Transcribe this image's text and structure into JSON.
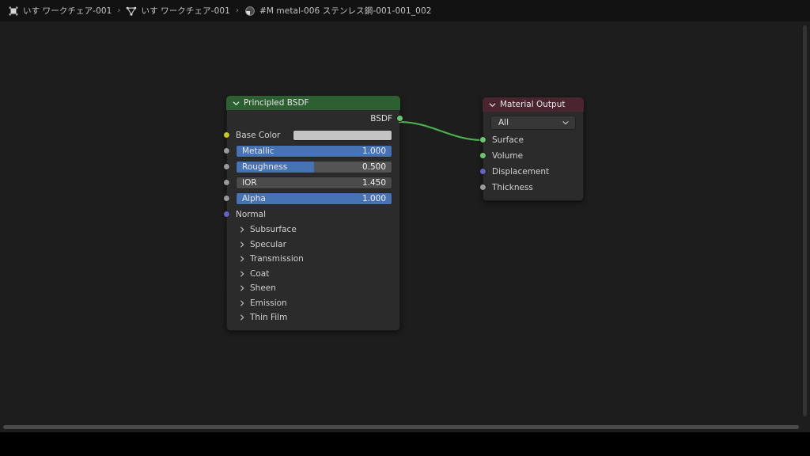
{
  "breadcrumb": {
    "separator": "›",
    "items": [
      {
        "icon": "object-icon",
        "label": "いす ワークチェア-001"
      },
      {
        "icon": "mesh-data-icon",
        "label": "いす ワークチェア-001"
      },
      {
        "icon": "material-icon",
        "label": "#M metal-006 ステンレス鋼-001-001_002"
      }
    ]
  },
  "colors": {
    "bsdf_header": "#2e5f32",
    "output_header": "#4a2530",
    "node_body": "#2b2b2b",
    "slider_fill": "#4772b3",
    "slider_track": "#545454",
    "socket_shader": "#6ec46e",
    "socket_color": "#c7c728",
    "socket_vector": "#6363c7",
    "socket_float": "#9a9a9a",
    "base_color_swatch": "#c4c4c4",
    "link": "#4caf50"
  },
  "nodes": {
    "principled_bsdf": {
      "title": "Principled BSDF",
      "output": {
        "label": "BSDF",
        "socket": "shader"
      },
      "inputs": [
        {
          "label": "Base Color",
          "type": "color",
          "socket": "color",
          "value": "#c4c4c4"
        },
        {
          "label": "Metallic",
          "type": "slider",
          "socket": "float",
          "value": "1.000",
          "fill": 100
        },
        {
          "label": "Roughness",
          "type": "slider",
          "socket": "float",
          "value": "0.500",
          "fill": 50
        },
        {
          "label": "IOR",
          "type": "slider",
          "socket": "float",
          "value": "1.450",
          "fill": 0
        },
        {
          "label": "Alpha",
          "type": "slider",
          "socket": "float",
          "value": "1.000",
          "fill": 100
        },
        {
          "label": "Normal",
          "type": "plain",
          "socket": "vector",
          "value": ""
        }
      ],
      "panels": [
        {
          "label": "Subsurface"
        },
        {
          "label": "Specular"
        },
        {
          "label": "Transmission"
        },
        {
          "label": "Coat"
        },
        {
          "label": "Sheen"
        },
        {
          "label": "Emission"
        },
        {
          "label": "Thin Film"
        }
      ]
    },
    "material_output": {
      "title": "Material Output",
      "target": {
        "label": "All"
      },
      "inputs": [
        {
          "label": "Surface",
          "socket": "shader"
        },
        {
          "label": "Volume",
          "socket": "shader"
        },
        {
          "label": "Displacement",
          "socket": "vector"
        },
        {
          "label": "Thickness",
          "socket": "float"
        }
      ]
    }
  }
}
